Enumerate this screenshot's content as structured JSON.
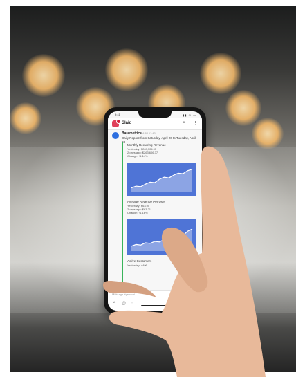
{
  "phone": {
    "status_time": "9:41",
    "status_icons": "▮▮ ◠ ▭",
    "workspace_name": "Slaid",
    "workspace_badge": "●"
  },
  "message": {
    "app_name": "Baremetrics",
    "app_meta": "APP 11:43",
    "daily_report": "Daily Report: from Saturday, April 20 to Tuesday, April 23"
  },
  "attachments": [
    {
      "title": "Monthly Recurring Revenue",
      "lines": [
        "Yesterday: $269,304.95",
        "2 days ago: $263,606.37",
        "Change: ↑1.14%"
      ],
      "chart_points": [
        0.15,
        0.22,
        0.2,
        0.3,
        0.38,
        0.36,
        0.5,
        0.58,
        0.55,
        0.66,
        0.74,
        0.72,
        0.84,
        0.9
      ]
    },
    {
      "title": "Average Revenue Per User",
      "lines": [
        "Yesterday: $63.95",
        "2 days ago: $63.21",
        "Change: ↑1.16%"
      ],
      "chart_points": [
        0.18,
        0.24,
        0.22,
        0.3,
        0.28,
        0.35,
        0.33,
        0.42,
        0.4,
        0.52,
        0.6,
        0.56,
        0.72,
        0.8
      ]
    },
    {
      "title": "Active Customers",
      "lines": [
        "Yesterday: 4496"
      ],
      "chart_points": []
    }
  ],
  "composer": {
    "placeholder": "Message #general"
  },
  "colors": {
    "chart_fill": "#4f74d6",
    "attach_bar": "#39b45a",
    "workspace_logo": "#e0405a"
  }
}
